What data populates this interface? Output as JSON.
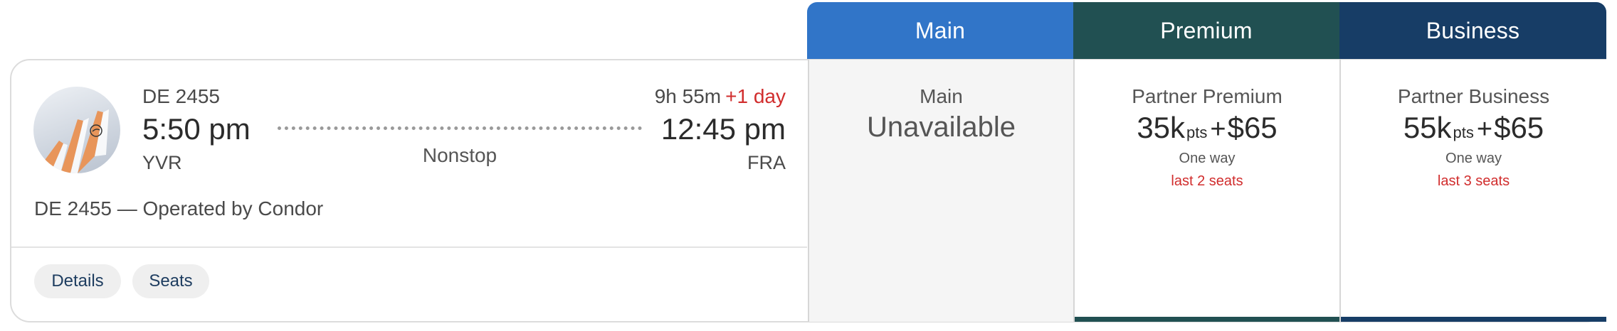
{
  "cabins": {
    "main": "Main",
    "premium": "Premium",
    "business": "Business"
  },
  "flight": {
    "number": "DE 2455",
    "departure_time": "5:50 pm",
    "departure_code": "YVR",
    "stops": "Nonstop",
    "duration": "9h 55m",
    "day_offset": "+1 day",
    "arrival_time": "12:45 pm",
    "arrival_code": "FRA",
    "operated_by": "DE 2455 — Operated by Condor",
    "airline_logo_icon": "condor-logo-icon",
    "colors": {
      "day_offset": "#d12d2d"
    }
  },
  "actions": {
    "details": "Details",
    "seats": "Seats"
  },
  "fares": {
    "main": {
      "label": "Main",
      "status": "Unavailable"
    },
    "premium": {
      "label": "Partner Premium",
      "points": "35k",
      "points_unit": "pts",
      "plus": "+",
      "cash": "$65",
      "trip": "One way",
      "seats_left": "last 2 seats"
    },
    "business": {
      "label": "Partner Business",
      "points": "55k",
      "points_unit": "pts",
      "plus": "+",
      "cash": "$65",
      "trip": "One way",
      "seats_left": "last 3 seats"
    }
  },
  "colors": {
    "main_header": "#3175c8",
    "premium_header": "#215052",
    "business_header": "#173d66",
    "alert": "#d12d2d"
  }
}
